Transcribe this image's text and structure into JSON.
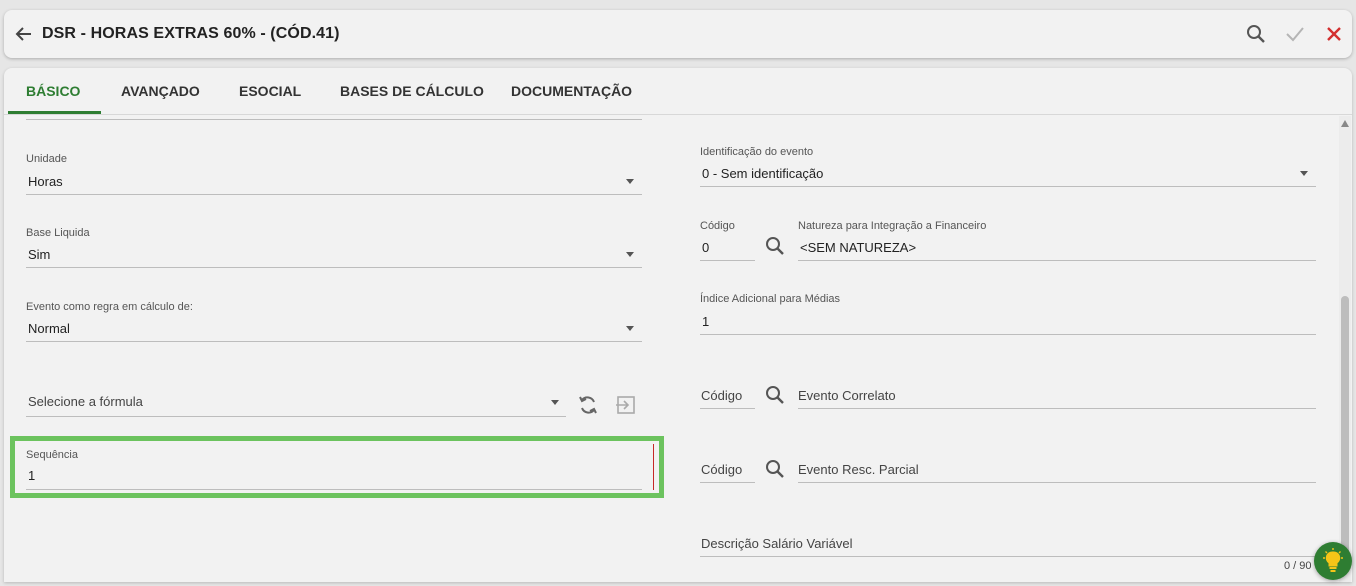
{
  "header": {
    "title": "DSR - HORAS EXTRAS 60% - (CÓD.41)",
    "actions": {
      "search": "search-icon",
      "confirm": "check-icon",
      "close": "close-icon"
    },
    "close_color": "#d32f2f"
  },
  "tabs": [
    {
      "label": "BÁSICO",
      "active": true
    },
    {
      "label": "AVANÇADO"
    },
    {
      "label": "ESOCIAL"
    },
    {
      "label": "BASES DE CÁLCULO"
    },
    {
      "label": "DOCUMENTAÇÃO"
    }
  ],
  "accent_color": "#2e7d32",
  "left": {
    "unidade": {
      "label": "Unidade",
      "value": "Horas"
    },
    "base_liquida": {
      "label": "Base Liquida",
      "value": "Sim"
    },
    "evento_regra": {
      "label": "Evento como regra em cálculo de:",
      "value": "Normal"
    },
    "formula": {
      "placeholder": "Selecione a fórmula"
    },
    "sequencia": {
      "label": "Sequência",
      "value": "1"
    }
  },
  "right": {
    "identificacao": {
      "label": "Identificação do evento",
      "value": "0 - Sem identificação"
    },
    "codigo": {
      "label": "Código",
      "value": "0"
    },
    "natureza": {
      "label": "Natureza para Integração a Financeiro",
      "value": "<SEM NATUREZA>"
    },
    "indice": {
      "label": "Índice Adicional para Médias",
      "value": "1"
    },
    "correlato": {
      "code_placeholder": "Código",
      "placeholder": "Evento Correlato"
    },
    "resc_parcial": {
      "code_placeholder": "Código",
      "placeholder": "Evento Resc. Parcial"
    },
    "descricao_salario": {
      "placeholder": "Descrição Salário Variável",
      "counter": "0 / 90"
    }
  }
}
